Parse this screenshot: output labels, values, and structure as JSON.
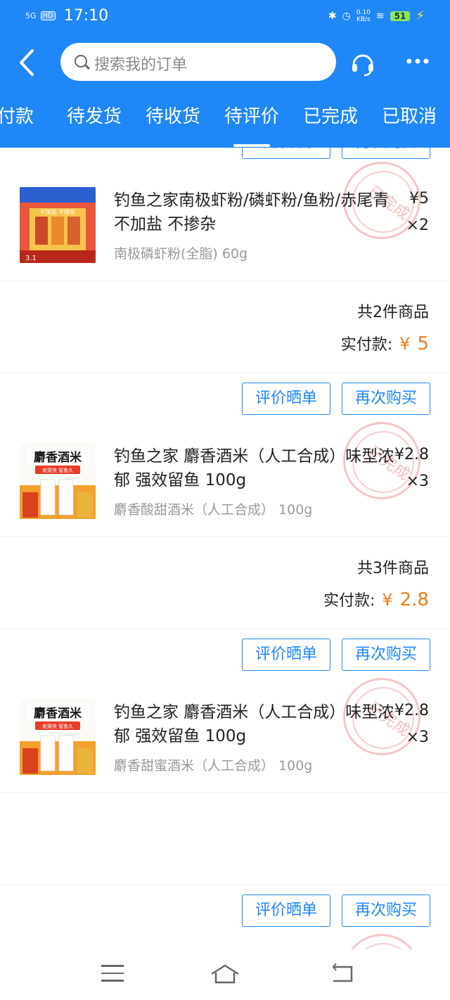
{
  "status_bar": {
    "signal": "5G",
    "hd": "HD",
    "time": "17:10",
    "net_speed": "0.10\nKB/s",
    "battery": "51"
  },
  "search": {
    "placeholder": "搜索我的订单"
  },
  "tabs": [
    {
      "label": "付款"
    },
    {
      "label": "待发货"
    },
    {
      "label": "待收货"
    },
    {
      "label": "待评价"
    },
    {
      "label": "已完成"
    },
    {
      "label": "已取消"
    }
  ],
  "buttons": {
    "review": "评价晒单",
    "rebuy": "再次购买"
  },
  "orders": [
    {
      "item": {
        "name": "钓鱼之家南极虾粉/磷虾粉/鱼粉/赤尾青 不加盐 不掺杂",
        "spec": "南极磷虾粉(全脂) 60g",
        "price": "¥5",
        "qty": "×2",
        "thumb_text": [
          "不加盐 不掺杂",
          "3.1"
        ]
      },
      "count": "共2件商品",
      "paid_label": "实付款:",
      "currency": "¥",
      "paid_amount": "5"
    },
    {
      "item": {
        "name": "钓鱼之家 麝香酒米（人工合成）味型浓郁 强效留鱼 100g",
        "spec": "麝香酸甜酒米（人工合成） 100g",
        "price": "¥2.8",
        "qty": "×3",
        "thumb_text": [
          "麝香酒米",
          "发窝快 留鱼久"
        ]
      },
      "count": "共3件商品",
      "paid_label": "实付款:",
      "currency": "¥",
      "paid_amount": "2.8"
    },
    {
      "item": {
        "name": "钓鱼之家 麝香酒米（人工合成）味型浓郁 强效留鱼 100g",
        "spec": "麝香甜蜜酒米（人工合成） 100g",
        "price": "¥2.8",
        "qty": "×3",
        "thumb_text": [
          "麝香酒米",
          "发窝快 留鱼久"
        ]
      }
    }
  ],
  "stamp_text": "已完成",
  "colors": {
    "primary": "#1f87f7",
    "price": "#f07a1e"
  }
}
